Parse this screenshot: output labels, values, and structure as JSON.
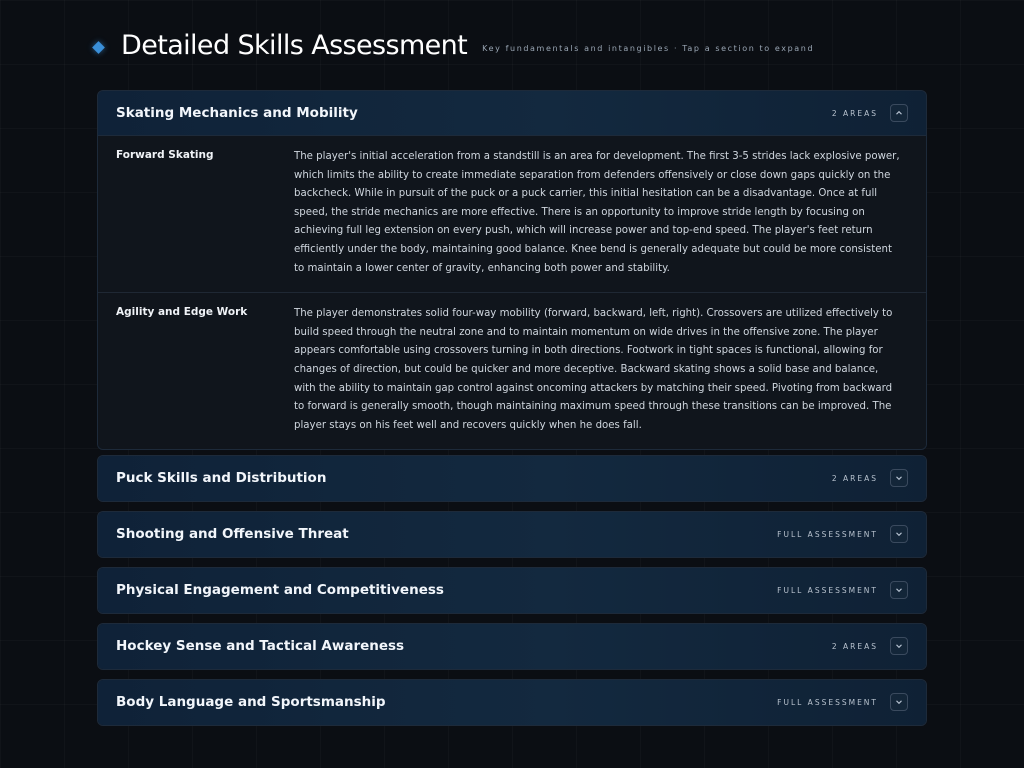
{
  "header": {
    "title": "Detailed Skills Assessment",
    "subtitle": "Key fundamentals and intangibles · Tap a section to expand"
  },
  "sections": [
    {
      "title": "Skating Mechanics and Mobility",
      "badge": "2 AREAS",
      "expanded": true,
      "areas": [
        {
          "name": "Forward Skating",
          "text": "The player's initial acceleration from a standstill is an area for development. The first 3-5 strides lack explosive power, which limits the ability to create immediate separation from defenders offensively or close down gaps quickly on the backcheck. While in pursuit of the puck or a puck carrier, this initial hesitation can be a disadvantage. Once at full speed, the stride mechanics are more effective. There is an opportunity to improve stride length by focusing on achieving full leg extension on every push, which will increase power and top-end speed. The player's feet return efficiently under the body, maintaining good balance. Knee bend is generally adequate but could be more consistent to maintain a lower center of gravity, enhancing both power and stability."
        },
        {
          "name": "Agility and Edge Work",
          "text": "The player demonstrates solid four-way mobility (forward, backward, left, right). Crossovers are utilized effectively to build speed through the neutral zone and to maintain momentum on wide drives in the offensive zone. The player appears comfortable using crossovers turning in both directions. Footwork in tight spaces is functional, allowing for changes of direction, but could be quicker and more deceptive. Backward skating shows a solid base and balance, with the ability to maintain gap control against oncoming attackers by matching their speed. Pivoting from backward to forward is generally smooth, though maintaining maximum speed through these transitions can be improved. The player stays on his feet well and recovers quickly when he does fall."
        }
      ]
    },
    {
      "title": "Puck Skills and Distribution",
      "badge": "2 AREAS",
      "expanded": false
    },
    {
      "title": "Shooting and Offensive Threat",
      "badge": "FULL ASSESSMENT",
      "expanded": false
    },
    {
      "title": "Physical Engagement and Competitiveness",
      "badge": "FULL ASSESSMENT",
      "expanded": false
    },
    {
      "title": "Hockey Sense and Tactical Awareness",
      "badge": "2 AREAS",
      "expanded": false
    },
    {
      "title": "Body Language and Sportsmanship",
      "badge": "FULL ASSESSMENT",
      "expanded": false
    }
  ],
  "colors": {
    "accent": "#3a8fd8",
    "header_bg": "#13293f",
    "page_bg": "#0b0e13"
  }
}
